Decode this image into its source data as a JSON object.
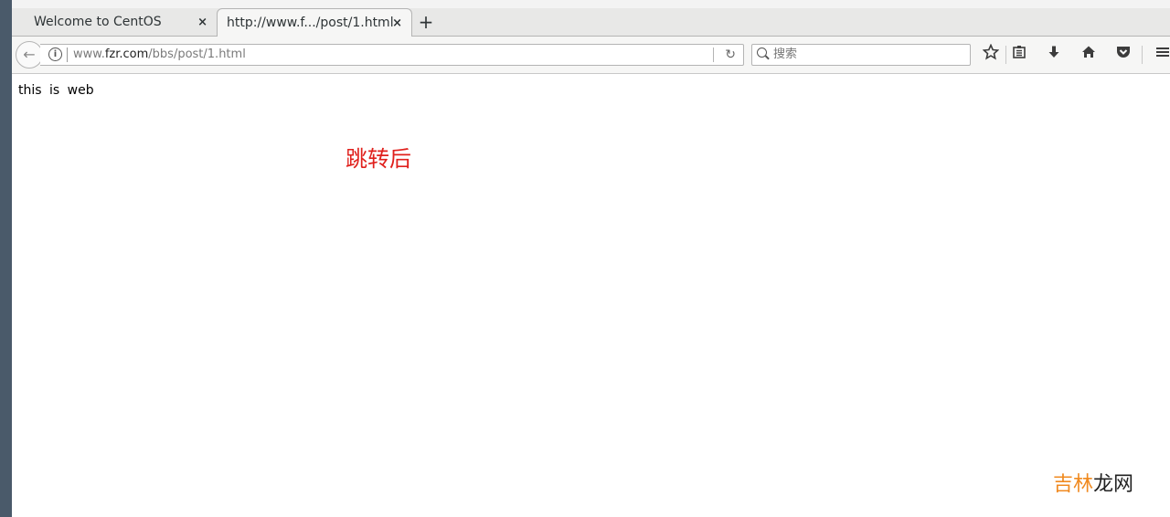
{
  "tabs": [
    {
      "label": "Welcome to CentOS",
      "active": false
    },
    {
      "label": "http://www.f.../post/1.html",
      "active": true
    }
  ],
  "tab_close_icon": "×",
  "new_tab_icon": "+",
  "navbar": {
    "back_icon": "←",
    "url_prefix": "www.",
    "url_host": "fzr.com",
    "url_path": "/bbs/post/1.html",
    "reload_icon": "↻",
    "search_placeholder": "搜索",
    "toolbar_icons": [
      "star-icon",
      "reading-list-icon",
      "download-icon",
      "home-icon",
      "pocket-icon",
      "menu-icon"
    ]
  },
  "page": {
    "body_text": "this is web",
    "redirect_text": "跳转后"
  },
  "watermark": {
    "part1": "吉林",
    "part2": "龙网"
  }
}
